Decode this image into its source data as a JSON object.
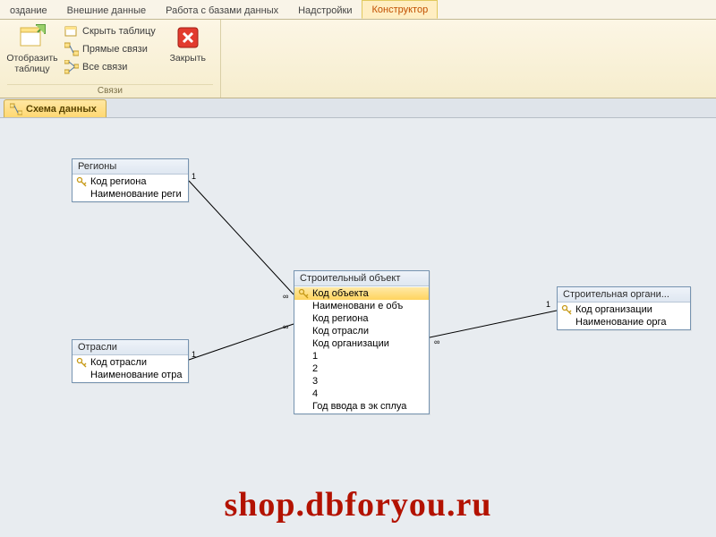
{
  "ribbon": {
    "tabs": [
      "оздание",
      "Внешние данные",
      "Работа с базами данных",
      "Надстройки",
      "Конструктор"
    ],
    "active_tab_index": 4,
    "groups": {
      "relations": {
        "label": "Связи",
        "show_table": "Отобразить\nтаблицу",
        "hide_table": "Скрыть таблицу",
        "direct_rel": "Прямые связи",
        "all_rel": "Все связи",
        "close": "Закрыть"
      }
    }
  },
  "doctab": {
    "title": "Схема данных"
  },
  "tables": {
    "regions": {
      "title": "Регионы",
      "fields": [
        "Код региона",
        "Наименование реги"
      ],
      "key_index": 0
    },
    "industries": {
      "title": "Отрасли",
      "fields": [
        "Код отрасли",
        "Наименование отра"
      ],
      "key_index": 0
    },
    "object": {
      "title": "Строительный объект",
      "fields": [
        "Код объекта",
        "Наименовани е объ",
        "Код региона",
        "Код отрасли",
        "Код организации",
        "1",
        "2",
        "3",
        "4",
        "Год ввода в эк сплуа"
      ],
      "key_index": 0
    },
    "org": {
      "title": "Строительная органи...",
      "fields": [
        "Код организации",
        "Наименование орга"
      ],
      "key_index": 0
    }
  },
  "cardinality": {
    "one": "1",
    "many": "∞"
  },
  "watermark": "shop.dbforyou.ru"
}
